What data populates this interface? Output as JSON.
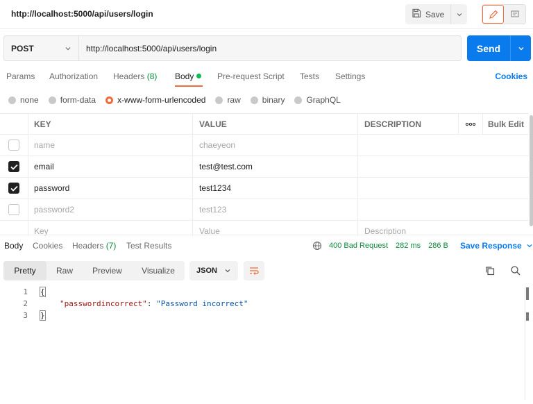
{
  "request": {
    "title": "http://localhost:5000/api/users/login",
    "save_label": "Save",
    "method": "POST",
    "url": "http://localhost:5000/api/users/login",
    "send_label": "Send"
  },
  "tabs": {
    "params": "Params",
    "authorization": "Authorization",
    "headers": "Headers",
    "headers_count": "(8)",
    "body": "Body",
    "pre_request": "Pre-request Script",
    "tests": "Tests",
    "settings": "Settings",
    "cookies": "Cookies"
  },
  "body_types": {
    "none": "none",
    "form_data": "form-data",
    "urlencoded": "x-www-form-urlencoded",
    "raw": "raw",
    "binary": "binary",
    "graphql": "GraphQL",
    "selected": "x-www-form-urlencoded"
  },
  "params_table": {
    "headers": {
      "key": "KEY",
      "value": "VALUE",
      "description": "DESCRIPTION",
      "more": "ooo",
      "bulk_edit": "Bulk Edit"
    },
    "rows": [
      {
        "checked": false,
        "key": "name",
        "value": "chaeyeon"
      },
      {
        "checked": true,
        "key": "email",
        "value": "test@test.com"
      },
      {
        "checked": true,
        "key": "password",
        "value": "test1234"
      },
      {
        "checked": false,
        "key": "password2",
        "value": "test123"
      }
    ],
    "placeholders": {
      "key": "Key",
      "value": "Value",
      "description": "Description"
    }
  },
  "response": {
    "tabs": {
      "body": "Body",
      "cookies": "Cookies",
      "headers": "Headers",
      "headers_count": "(7)",
      "test_results": "Test Results"
    },
    "status": "400 Bad Request",
    "time": "282 ms",
    "size": "286 B",
    "save_response": "Save Response",
    "views": {
      "pretty": "Pretty",
      "raw": "Raw",
      "preview": "Preview",
      "visualize": "Visualize"
    },
    "format": "JSON",
    "lines": [
      {
        "num": "1",
        "text": "{"
      },
      {
        "num": "2",
        "key": "\"passwordincorrect\"",
        "sep": ": ",
        "value": "\"Password incorrect\""
      },
      {
        "num": "3",
        "text": "}"
      }
    ]
  },
  "icons": {
    "save": "save-icon",
    "edit": "pencil-icon",
    "comment": "comment-icon",
    "globe": "globe-icon",
    "copy": "copy-icon",
    "search": "search-icon",
    "wrap": "wrap-lines-icon"
  },
  "colors": {
    "accent_orange": "#f26b3a",
    "send_blue": "#097bed",
    "status_green": "#0a8a3a",
    "body_dot_green": "#0cbb52"
  }
}
